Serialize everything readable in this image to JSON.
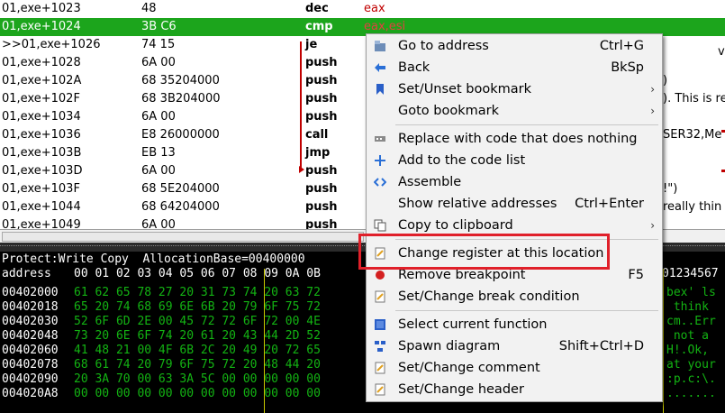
{
  "disasm": {
    "rows": [
      {
        "addr": "01,exe+1023",
        "bytes": "48",
        "op": "dec",
        "arg": "eax"
      },
      {
        "addr": "01,exe+1024",
        "bytes": "3B C6",
        "op": "cmp",
        "arg": "eax,esi"
      },
      {
        "addr": ">>01,exe+1026",
        "bytes": "74 15",
        "op": "je",
        "arg": ""
      },
      {
        "addr": "01,exe+1028",
        "bytes": "6A 00",
        "op": "push",
        "arg": ""
      },
      {
        "addr": "01,exe+102A",
        "bytes": "68 35204000",
        "op": "push",
        "arg": ""
      },
      {
        "addr": "01,exe+102F",
        "bytes": "68 3B204000",
        "op": "push",
        "arg": ""
      },
      {
        "addr": "01,exe+1034",
        "bytes": "6A 00",
        "op": "push",
        "arg": ""
      },
      {
        "addr": "01,exe+1036",
        "bytes": "E8 26000000",
        "op": "call",
        "arg": ""
      },
      {
        "addr": "01,exe+103B",
        "bytes": "EB 13",
        "op": "jmp",
        "arg": ""
      },
      {
        "addr": "01,exe+103D",
        "bytes": "6A 00",
        "op": "push",
        "arg": ""
      },
      {
        "addr": "01,exe+103F",
        "bytes": "68 5E204000",
        "op": "push",
        "arg": ""
      },
      {
        "addr": "01,exe+1044",
        "bytes": "68 64204000",
        "op": "push",
        "arg": ""
      },
      {
        "addr": "01,exe+1049",
        "bytes": "6A 00",
        "op": "push",
        "arg": ""
      }
    ],
    "side": [
      {
        "text": "v"
      },
      {
        "text": ")"
      },
      {
        "text": "). This is re"
      },
      {
        "text": "SER32,Me"
      },
      {
        "text": "!\")"
      },
      {
        "text": "really thin"
      }
    ]
  },
  "hexview": {
    "info": "Protect:Write Copy  AllocationBase=00400000",
    "header_label": "address",
    "header_bytes": "00 01 02 03 04 05 06 07 08 09 0A 0B",
    "header_ascii": "01234567",
    "rows": [
      {
        "addr": "00402000",
        "bytes": "61 62 65 78 27 20 31 73 74 20 63 72",
        "ascii": "bex' ls"
      },
      {
        "addr": "00402018",
        "bytes": "65 20 74 68 69 6E 6B 20 79 6F 75 72",
        "ascii": " think"
      },
      {
        "addr": "00402030",
        "bytes": "52 6F 6D 2E 00 45 72 72 6F 72 00 4E",
        "ascii": "cm..Err"
      },
      {
        "addr": "00402048",
        "bytes": "73 20 6E 6F 74 20 61 20 43 44 2D 52",
        "ascii": " not a"
      },
      {
        "addr": "00402060",
        "bytes": "41 48 21 00 4F 6B 2C 20 49 20 72 65",
        "ascii": "H!.Ok,"
      },
      {
        "addr": "00402078",
        "bytes": "68 61 74 20 79 6F 75 72 20 48 44 20",
        "ascii": "at your"
      },
      {
        "addr": "00402090",
        "bytes": "20 3A 70 00 63 3A 5C 00 00 00 00 00",
        "ascii": ":p.c:\\."
      },
      {
        "addr": "004020A8",
        "bytes": "00 00 00 00 00 00 00 00 00 00 00 00",
        "ascii": "......."
      }
    ]
  },
  "context_menu": {
    "items": [
      {
        "label": "Go to address",
        "shortcut": "Ctrl+G",
        "icon": "go-to-address-icon"
      },
      {
        "label": "Back",
        "shortcut": "BkSp",
        "icon": "back-arrow-icon"
      },
      {
        "label": "Set/Unset bookmark",
        "shortcut": "",
        "icon": "bookmark-icon",
        "submenu": true
      },
      {
        "label": "Goto bookmark",
        "shortcut": "",
        "icon": "",
        "submenu": true
      },
      {
        "label": "Replace with code that does nothing",
        "shortcut": "",
        "icon": "replace-nop-icon"
      },
      {
        "label": "Add to the code list",
        "shortcut": "",
        "icon": "plus-icon"
      },
      {
        "label": "Assemble",
        "shortcut": "",
        "icon": "assemble-icon"
      },
      {
        "label": "Show relative addresses",
        "shortcut": "Ctrl+Enter",
        "icon": ""
      },
      {
        "label": "Copy to clipboard",
        "shortcut": "",
        "icon": "copy-icon",
        "submenu": true
      },
      {
        "label": "Change register at this location",
        "shortcut": "",
        "icon": "change-register-icon"
      },
      {
        "label": "Remove breakpoint",
        "shortcut": "F5",
        "icon": "breakpoint-icon"
      },
      {
        "label": "Set/Change break condition",
        "shortcut": "",
        "icon": "break-condition-icon"
      },
      {
        "label": "Select current function",
        "shortcut": "",
        "icon": "select-function-icon"
      },
      {
        "label": "Spawn diagram",
        "shortcut": "Shift+Ctrl+D",
        "icon": "diagram-icon"
      },
      {
        "label": "Set/Change comment",
        "shortcut": "",
        "icon": "comment-icon"
      },
      {
        "label": "Set/Change header",
        "shortcut": "",
        "icon": "header-icon"
      }
    ],
    "submenu_glyph": "›"
  },
  "colors": {
    "highlight_row": "#1ca51c",
    "hex_green": "#13b313",
    "annotation_box": "#e0202a"
  }
}
